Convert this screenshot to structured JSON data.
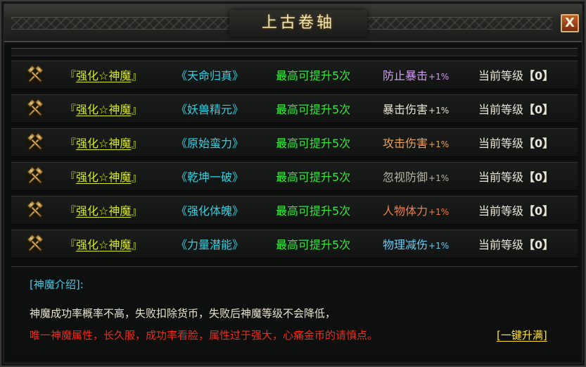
{
  "window": {
    "title": "上古卷轴",
    "close_label": "X"
  },
  "rows": [
    {
      "name": "『强化☆神魔』",
      "name_prefix": "『",
      "name_core": "强化☆神魔",
      "name_suffix": "』",
      "skill": "《天命归真》",
      "limit": "最高可提升5次",
      "attr": "防止暴击",
      "attr_pct": "+1%",
      "attr_color": "#c9a0e6",
      "level_label": "当前等级",
      "level_value": "【0】"
    },
    {
      "name": "『强化☆神魔』",
      "name_prefix": "『",
      "name_core": "强化☆神魔",
      "name_suffix": "』",
      "skill": "《妖兽精元》",
      "limit": "最高可提升5次",
      "attr": "暴击伤害",
      "attr_pct": "+1%",
      "attr_color": "#e6e3d4",
      "level_label": "当前等级",
      "level_value": "【0】"
    },
    {
      "name": "『强化☆神魔』",
      "name_prefix": "『",
      "name_core": "强化☆神魔",
      "name_suffix": "』",
      "skill": "《原始蛮力》",
      "limit": "最高可提升5次",
      "attr": "攻击伤害",
      "attr_pct": "+1%",
      "attr_color": "#e8a25a",
      "level_label": "当前等级",
      "level_value": "【0】"
    },
    {
      "name": "『强化☆神魔』",
      "name_prefix": "『",
      "name_core": "强化☆神魔",
      "name_suffix": "』",
      "skill": "《乾坤一破》",
      "limit": "最高可提升5次",
      "attr": "忽视防御",
      "attr_pct": "+1%",
      "attr_color": "#b8b3a2",
      "level_label": "当前等级",
      "level_value": "【0】"
    },
    {
      "name": "『强化☆神魔』",
      "name_prefix": "『",
      "name_core": "强化☆神魔",
      "name_suffix": "』",
      "skill": "《强化体魄》",
      "limit": "最高可提升5次",
      "attr": "人物体力",
      "attr_pct": "+1%",
      "attr_color": "#f07c4a",
      "level_label": "当前等级",
      "level_value": "【0】"
    },
    {
      "name": "『强化☆神魔』",
      "name_prefix": "『",
      "name_core": "强化☆神魔",
      "name_suffix": "』",
      "skill": "《力量潜能》",
      "limit": "最高可提升5次",
      "attr": "物理减伤",
      "attr_pct": "+1%",
      "attr_color": "#6cc8f0",
      "level_label": "当前等级",
      "level_value": "【0】"
    }
  ],
  "intro": {
    "heading": "[神魔介绍]:",
    "line1": "神魔成功率概率不高，失败扣除货币，失败后神魔等级不会降低，",
    "line2": "唯一神魔属性，长久服，成功率看脸，属性过于强大，心痛金币的请慎点。",
    "upgrade_link": "[一键升满]"
  },
  "colors": {
    "name": "#d6e81e",
    "skill": "#2fd0e0",
    "limit": "#34e63a",
    "intro_heading": "#44c9e8",
    "warning": "#f02a1a",
    "upgrade_link": "#ffe32a"
  },
  "icons": {
    "row_icon": "crossed-hammers-icon",
    "close": "close-icon"
  }
}
